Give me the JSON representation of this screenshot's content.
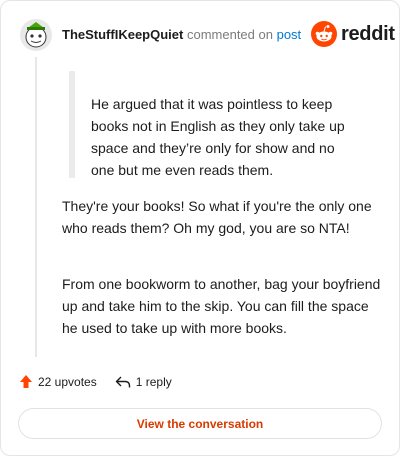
{
  "header": {
    "username": "TheStuffIKeepQuiet",
    "commented_text": "commented on",
    "post_link": "post",
    "brand": "reddit"
  },
  "quote": "He argued that it was pointless to keep books not in English as they only take up space and they’re only for show and no one but me even reads them.",
  "paragraphs": [
    "They're your books! So what if you're the only one who reads them? Oh my god, you are so NTA!",
    "From one bookworm to another, bag your boyfriend up and take him to the skip. You can fill the space he used to take up with more books."
  ],
  "actions": {
    "upvotes": "22 upvotes",
    "replies": "1 reply"
  },
  "cta": "View the conversation",
  "colors": {
    "upvote": "#ff4500",
    "link": "#0079d3",
    "cta": "#d93a00"
  },
  "icons": [
    "avatar-icon",
    "reddit-logo-icon",
    "upvote-arrow-icon",
    "reply-arrow-icon"
  ]
}
